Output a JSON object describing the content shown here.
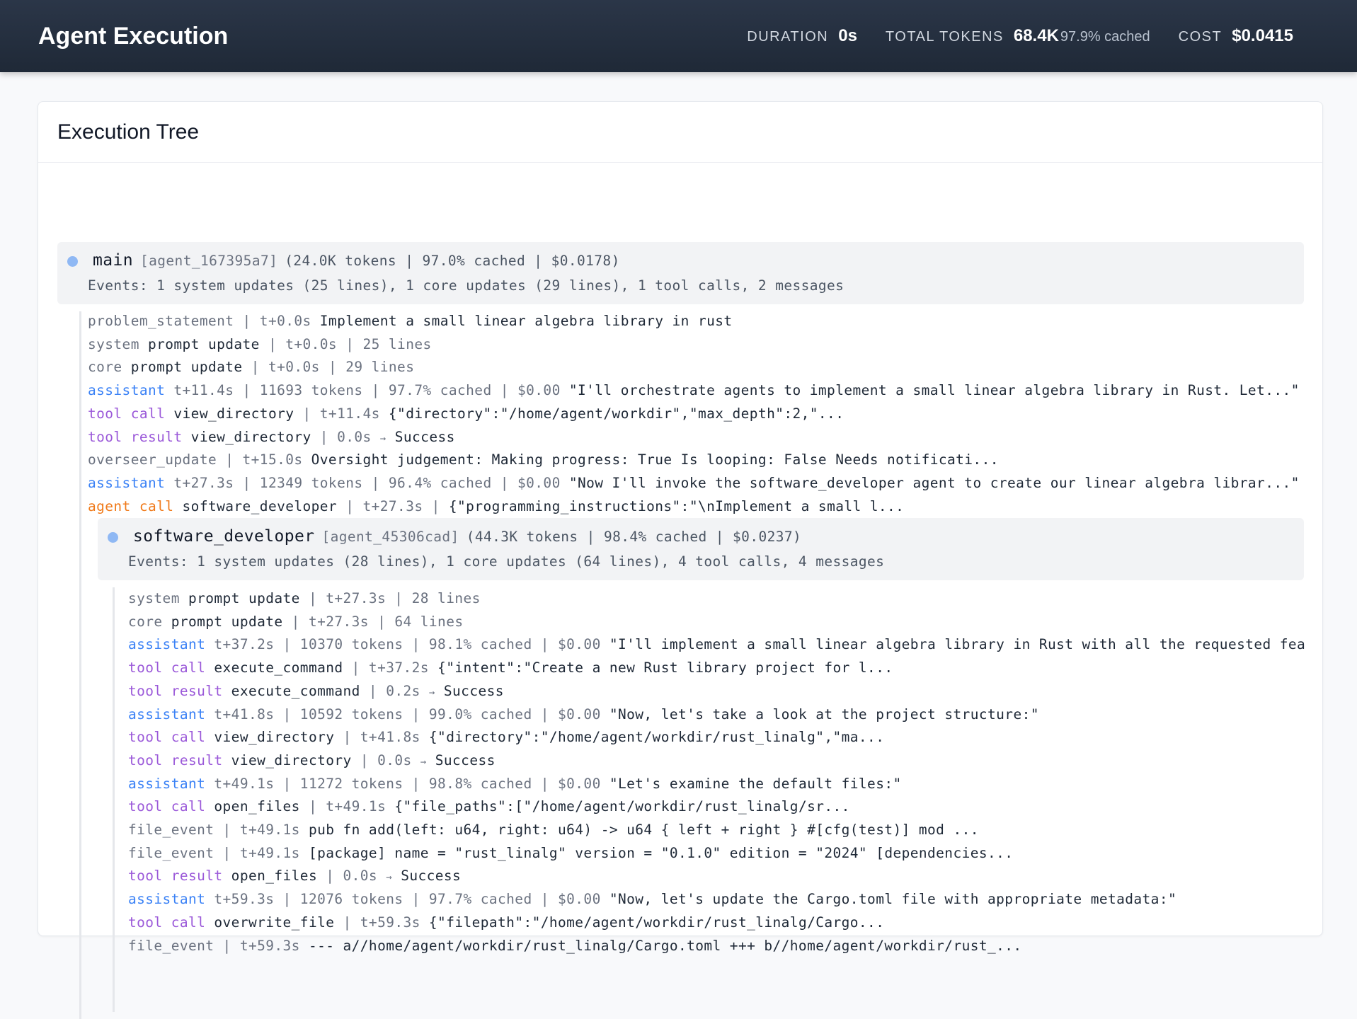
{
  "header": {
    "title": "Agent Execution",
    "duration_label": "DURATION",
    "duration_value": "0s",
    "tokens_label": "TOTAL TOKENS",
    "tokens_value": "68.4K",
    "tokens_cached": "97.9% cached",
    "cost_label": "COST",
    "cost_value": "$0.0415"
  },
  "panel": {
    "title": "Execution Tree"
  },
  "main_agent": {
    "name": "main",
    "id": "[agent_167395a7]",
    "stats": "(24.0K tokens | 97.0% cached | $0.0178)",
    "events": "Events: 1 system updates (25 lines), 1 core updates (29 lines), 1 tool calls, 2 messages",
    "items": [
      {
        "k1": "problem_statement",
        "k2": "",
        "meta": " | t+0.0s ",
        "body": "Implement a small linear algebra library in rust"
      },
      {
        "k1": "system ",
        "k2": "prompt update",
        "meta": " | t+0.0s | 25 lines",
        "body": ""
      },
      {
        "k1": "core ",
        "k2": "prompt update",
        "meta": " | t+0.0s | 29 lines",
        "body": ""
      },
      {
        "k1": "assistant",
        "k2": "",
        "meta": " t+11.4s | 11693 tokens | 97.7% cached | $0.00 ",
        "body": "\"I'll orchestrate agents to implement a small linear algebra library in Rust. Let...\""
      },
      {
        "k1": "tool call",
        "k2": " view_directory",
        "meta": " | t+11.4s ",
        "body": "{\"directory\":\"/home/agent/workdir\",\"max_depth\":2,\"..."
      },
      {
        "k1": "tool result",
        "k2": " view_directory",
        "meta": " | 0.0s ",
        "arrow": "→",
        "body": " Success"
      },
      {
        "k1": "overseer_update",
        "k2": "",
        "meta": " | t+15.0s ",
        "body": "Oversight judgement: Making progress: True Is looping: False Needs notificati..."
      },
      {
        "k1": "assistant",
        "k2": "",
        "meta": " t+27.3s | 12349 tokens | 96.4% cached | $0.00 ",
        "body": "\"Now I'll invoke the software_developer agent to create our linear algebra librar...\""
      },
      {
        "k1": "agent call",
        "k2": " software_developer",
        "meta": " | t+27.3s | ",
        "body": "{\"programming_instructions\":\"\\nImplement a small l..."
      }
    ]
  },
  "sub_agent": {
    "name": "software_developer",
    "id": "[agent_45306cad]",
    "stats": "(44.3K tokens | 98.4% cached | $0.0237)",
    "events": "Events: 1 system updates (28 lines), 1 core updates (64 lines), 4 tool calls, 4 messages",
    "items": [
      {
        "k1": "system ",
        "k2": "prompt update",
        "meta": " | t+27.3s | 28 lines",
        "body": ""
      },
      {
        "k1": "core ",
        "k2": "prompt update",
        "meta": " | t+27.3s | 64 lines",
        "body": ""
      },
      {
        "k1": "assistant",
        "k2": "",
        "meta": " t+37.2s | 10370 tokens | 98.1% cached | $0.00 ",
        "body": "\"I'll implement a small linear algebra library in Rust with all the requested fea…"
      },
      {
        "k1": "tool call",
        "k2": " execute_command",
        "meta": " | t+37.2s ",
        "body": "{\"intent\":\"Create a new Rust library project for l..."
      },
      {
        "k1": "tool result",
        "k2": " execute_command",
        "meta": " | 0.2s ",
        "arrow": "→",
        "body": " Success"
      },
      {
        "k1": "assistant",
        "k2": "",
        "meta": " t+41.8s | 10592 tokens | 99.0% cached | $0.00 ",
        "body": "\"Now, let's take a look at the project structure:\""
      },
      {
        "k1": "tool call",
        "k2": " view_directory",
        "meta": " | t+41.8s ",
        "body": "{\"directory\":\"/home/agent/workdir/rust_linalg\",\"ma..."
      },
      {
        "k1": "tool result",
        "k2": " view_directory",
        "meta": " | 0.0s ",
        "arrow": "→",
        "body": " Success"
      },
      {
        "k1": "assistant",
        "k2": "",
        "meta": " t+49.1s | 11272 tokens | 98.8% cached | $0.00 ",
        "body": "\"Let's examine the default files:\""
      },
      {
        "k1": "tool call",
        "k2": " open_files",
        "meta": " | t+49.1s ",
        "body": "{\"file_paths\":[\"/home/agent/workdir/rust_linalg/sr..."
      },
      {
        "k1": "file_event",
        "k2": "",
        "meta": " | t+49.1s ",
        "body": "pub fn add(left: u64, right: u64) -> u64 { left + right } #[cfg(test)] mod ..."
      },
      {
        "k1": "file_event",
        "k2": "",
        "meta": " | t+49.1s ",
        "body": "[package] name = \"rust_linalg\" version = \"0.1.0\" edition = \"2024\" [dependencies..."
      },
      {
        "k1": "tool result",
        "k2": " open_files",
        "meta": " | 0.0s ",
        "arrow": "→",
        "body": " Success"
      },
      {
        "k1": "assistant",
        "k2": "",
        "meta": " t+59.3s | 12076 tokens | 97.7% cached | $0.00 ",
        "body": "\"Now, let's update the Cargo.toml file with appropriate metadata:\""
      },
      {
        "k1": "tool call",
        "k2": " overwrite_file",
        "meta": " | t+59.3s ",
        "body": "{\"filepath\":\"/home/agent/workdir/rust_linalg/Cargo..."
      },
      {
        "k1": "file_event",
        "k2": "",
        "meta": " | t+59.3s ",
        "body": "--- a//home/agent/workdir/rust_linalg/Cargo.toml +++ b//home/agent/workdir/rust_..."
      }
    ]
  }
}
